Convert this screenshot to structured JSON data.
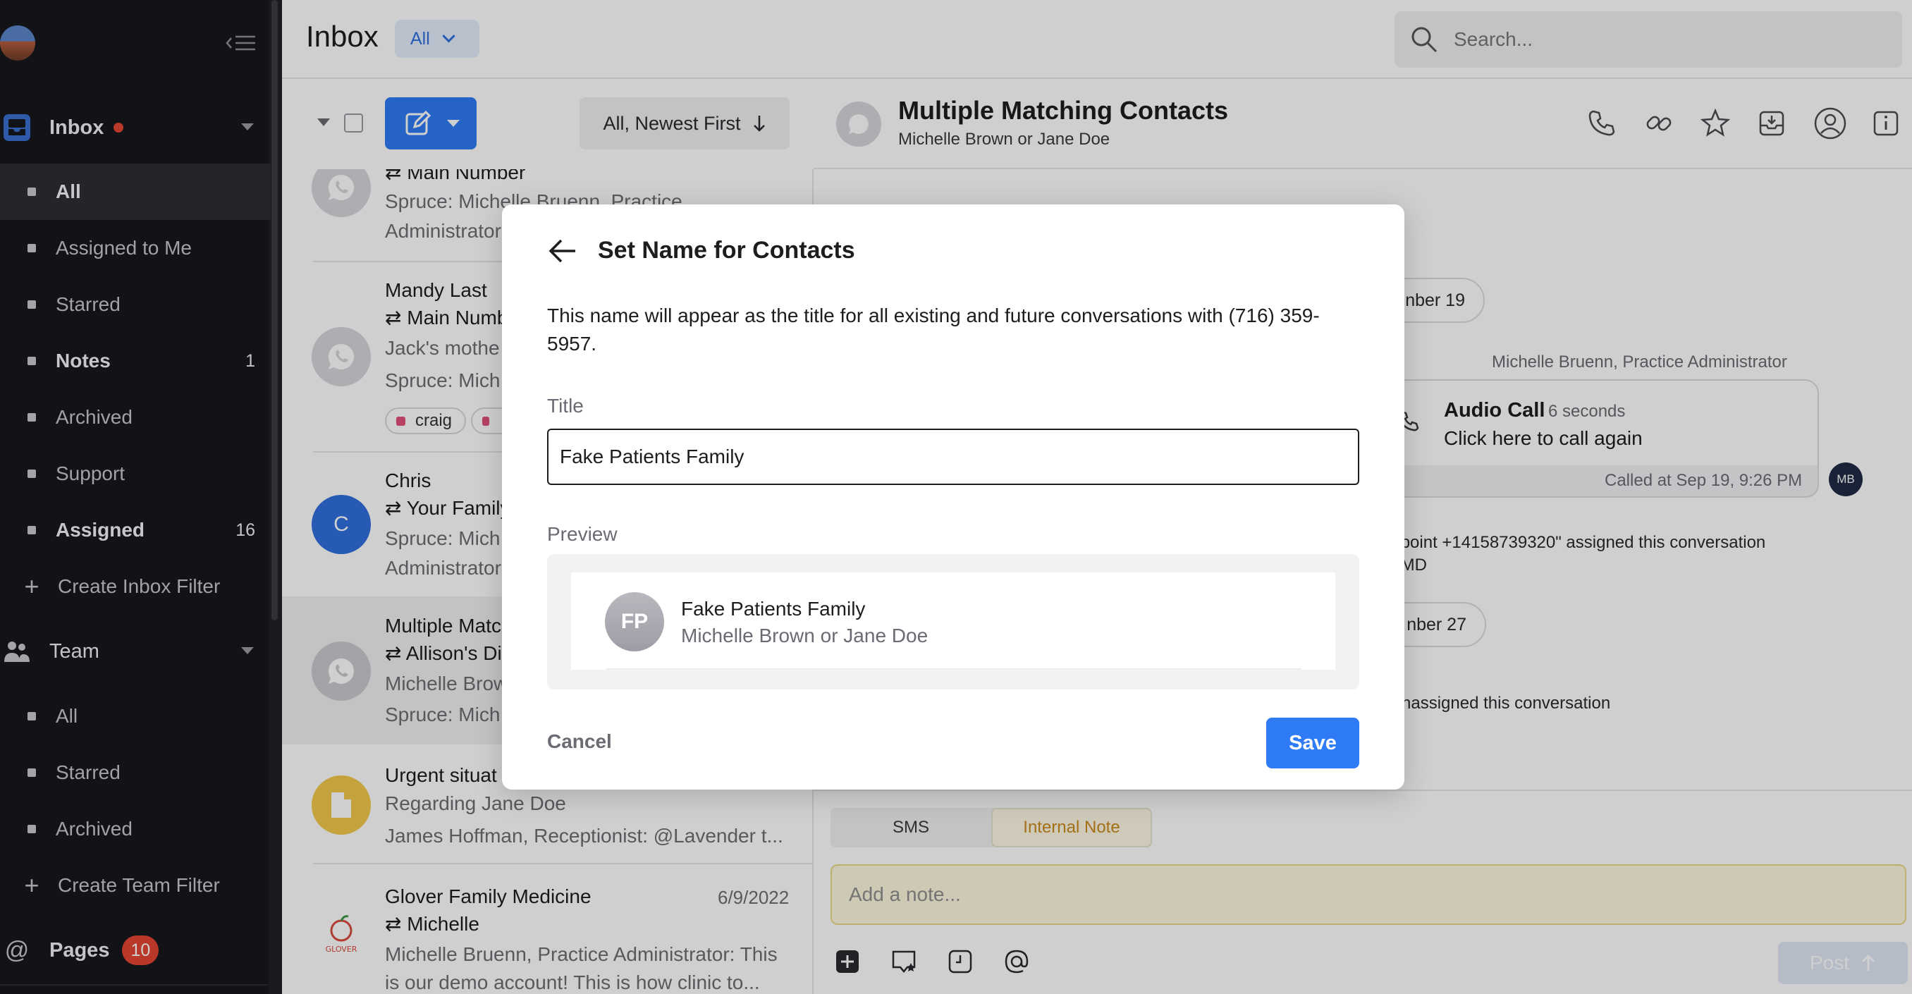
{
  "sidebar": {
    "inbox_label": "Inbox",
    "inbox_items": [
      {
        "label": "All",
        "count": ""
      },
      {
        "label": "Assigned to Me",
        "count": ""
      },
      {
        "label": "Starred",
        "count": ""
      },
      {
        "label": "Notes",
        "count": "1"
      },
      {
        "label": "Archived",
        "count": ""
      },
      {
        "label": "Support",
        "count": ""
      },
      {
        "label": "Assigned",
        "count": "16"
      }
    ],
    "create_inbox_filter": "Create Inbox Filter",
    "team_label": "Team",
    "team_items": [
      {
        "label": "All"
      },
      {
        "label": "Starred"
      },
      {
        "label": "Archived"
      }
    ],
    "create_team_filter": "Create Team Filter",
    "pages_label": "Pages",
    "pages_count": "10",
    "accent_color": "#e64533"
  },
  "header": {
    "title": "Inbox",
    "filter_value": "All",
    "search_placeholder": "Search..."
  },
  "list": {
    "sort_label": "All, Newest First",
    "conversations": [
      {
        "line1": "",
        "line2": "⇄ Main Number",
        "line3": "Spruce: Michelle Bruenn, Practice",
        "line4": "Administrator",
        "date": ""
      },
      {
        "line1": "Mandy Last",
        "line2": "⇄ Main Numb",
        "line3": "Jack's mothe",
        "line4": "Spruce: Mich",
        "tags": [
          "craig",
          ""
        ],
        "date": ""
      },
      {
        "line1": "Chris",
        "line2": "⇄ Your Family",
        "line3": "Spruce: Mich",
        "line4": "Administrator",
        "avatar_initial": "C",
        "date": ""
      },
      {
        "line1": "Multiple Matc",
        "line2": "⇄ Allison's Di",
        "line3": "Michelle Brow",
        "line4": "Spruce: Mich",
        "date": ""
      },
      {
        "line1": "Urgent situat",
        "line2": "Regarding Jane Doe",
        "line3": "James Hoffman, Receptionist: @Lavender t...",
        "line4": "",
        "date": ""
      },
      {
        "line1": "Glover Family Medicine",
        "line2": "⇄ Michelle",
        "line3": "Michelle Bruenn, Practice Administrator: This",
        "line4": "is our demo account! This is how clinic to...",
        "date": "6/9/2022"
      }
    ]
  },
  "detail": {
    "title": "Multiple Matching Contacts",
    "subtitle": "Michelle Brown or Jane Doe",
    "date_pill_1": "nber 19",
    "sender_label": "Michelle Bruenn, Practice Administrator",
    "call_title": "Audio Call",
    "call_duration": "6 seconds",
    "call_action": "Click here to call again",
    "call_time": "Called at Sep 19, 9:26 PM",
    "mb_initials": "MB",
    "event_1a": "ndpoint +14158739320\" assigned this conversation",
    "event_1b": "e, MD",
    "date_pill_2": "nber 27",
    "event_2": "r unassigned this conversation",
    "tab_sms": "SMS",
    "tab_note": "Internal Note",
    "note_placeholder": "Add a note...",
    "post_label": "Post"
  },
  "modal": {
    "title": "Set Name for Contacts",
    "description": "This name will appear as the title for all existing and future conversations with (716) 359-5957.",
    "title_label": "Title",
    "title_value": "Fake Patients Family",
    "preview_label": "Preview",
    "preview_initials": "FP",
    "preview_name": "Fake Patients Family",
    "preview_sub": "Michelle Brown or Jane Doe",
    "cancel_label": "Cancel",
    "save_label": "Save",
    "primary_color": "#2f7bf5"
  }
}
